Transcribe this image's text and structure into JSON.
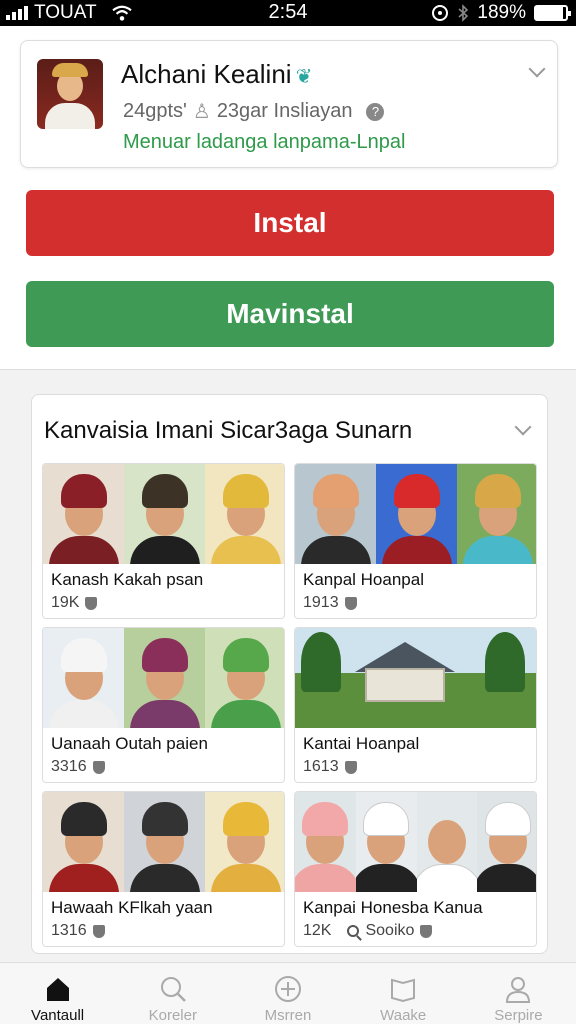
{
  "status_bar": {
    "carrier": "TOUAT",
    "time": "2:54",
    "battery": "189%",
    "battery_level": 0.9
  },
  "app": {
    "title": "Alchani Kealini",
    "meta_left": "24gpts'",
    "meta_right": "23gar Insliayan",
    "subtitle": "Menuar ladanga lanpama-Lnpal",
    "accent_green": "#2e9a4a"
  },
  "buttons": {
    "install": "Instal",
    "uninstall": "Mavinstal",
    "install_color": "#d32f2f",
    "uninstall_color": "#3f9a56"
  },
  "gallery": {
    "title": "Kanvaisia Imani Sicar3aga Sunarn",
    "items": [
      {
        "name": "Kanash Kakah psan",
        "count": "19K"
      },
      {
        "name": "Kanpal Hoanpal",
        "count": "1913"
      },
      {
        "name": "Uanaah Outah paien",
        "count": "3316"
      },
      {
        "name": "Kantai Hoanpal",
        "count": "1613"
      },
      {
        "name": "Hawaah KFlkah yaan",
        "count": "1316"
      },
      {
        "name": "Kanpai Honesba Kanua",
        "count": "12K",
        "extra": "Sooiko"
      }
    ]
  },
  "bottom_nav": [
    {
      "label": "Vantaull",
      "icon": "home-icon",
      "active": true
    },
    {
      "label": "Koreler",
      "icon": "search-icon",
      "active": false
    },
    {
      "label": "Msrren",
      "icon": "plus-circle-icon",
      "active": false
    },
    {
      "label": "Waake",
      "icon": "book-icon",
      "active": false
    },
    {
      "label": "Serpire",
      "icon": "profile-icon",
      "active": false
    }
  ]
}
